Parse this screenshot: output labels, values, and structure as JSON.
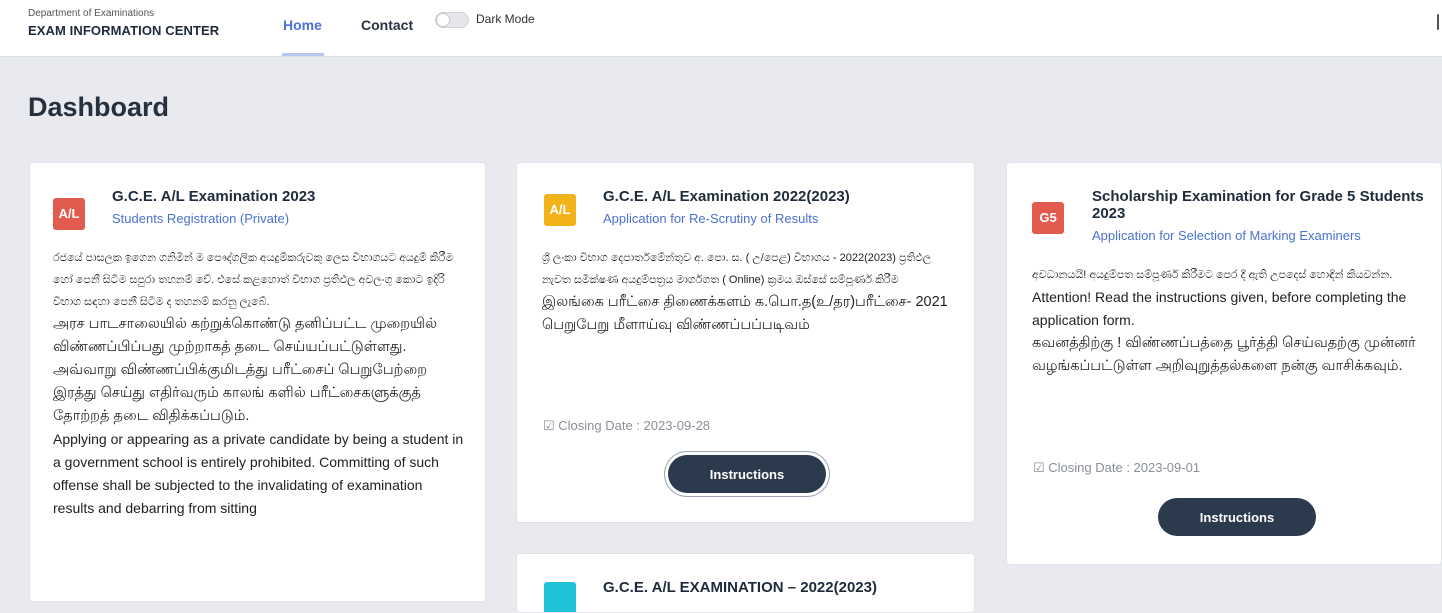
{
  "header": {
    "dept": "Department of Examinations",
    "brand": "EXAM INFORMATION CENTER",
    "nav": {
      "home": "Home",
      "contact": "Contact"
    },
    "dark_mode_label": "Dark Mode"
  },
  "page": {
    "title": "Dashboard"
  },
  "cards": [
    {
      "badge": "A/L",
      "badge_color": "#e35b4f",
      "title": "G.C.E. A/L Examination 2023",
      "subtitle": "Students Registration (Private)",
      "sinhala": "රජයේ පාසලක ඉගෙන ගනිමින් ම පෞද්ගලික අයදුම්කරුවකු ලෙස විභාගයට අයදුම් කිරීම හෝ පෙනී සිටීම සපුරා තහනම් වේ. එසේ කළහොත් විභාග ප්‍රතිඵල අවලංගු කොට ඉදිරි විභාග සඳහා පෙනී සිටීම ද තහනම් කරනු ලැබේ.",
      "tamil": "அரச பாடசாலையில் கற்றுக்கொண்டு தனிப்பட்ட முறையில் விண்ணப்பிப்பது முற்றாகத் தடை செய்யப்பட்டுள்ளது. அவ்வாறு விண்ணப்பிக்குமிடத்து பரீட்சைப் பெறுபேற்றை இரத்து செய்து எதிர்வரும் காலங் களில் பரீட்சைகளுக்குத் தோற்றத் தடை விதிக்கப்படும்.",
      "english": "Applying or appearing as a private candidate by being a student in a government school is entirely prohibited. Committing of such offense shall be subjected to the invalidating of examination results and debarring from sitting"
    },
    {
      "badge": "A/L",
      "badge_color": "#f1b21a",
      "title": "G.C.E. A/L Examination 2022(2023)",
      "subtitle": "Application for Re-Scrutiny of Results",
      "sinhala": "ශ්‍රී ලංකා විභාග දෙපාර්තමේන්තුව අ. පො. ස. ( උ/පෙළ) විභාගය - 2022(2023) ප්‍රතිඵල නැවත සමීක්ෂණ අයදුම්පත්‍රය මාර්ගගත ( Online) ක්‍රමය ඔස්සේ සම්පූර්ණ කිරීම",
      "tamil": "இலங்கை பரீட்சை திணைக்களம் க.பொ.த(உ/தர)பரீட்சை- 2021 பெறுபேறு மீளாய்வு விண்ணப்பப்படிவம்",
      "closing": "Closing Date : 2023-09-28",
      "button": "Instructions"
    },
    {
      "badge": "G5",
      "badge_color": "#e35b4f",
      "title": "Scholarship Examination for Grade 5 Students 2023",
      "subtitle": "Application for Selection of Marking Examiners",
      "sinhala": "අවධානයයි! අයදුම්පත සම්පූර්ණ කිරීමට පෙර දී ඇති උපදෙස් හොඳින් කියවන්න.",
      "english": "Attention! Read the instructions given, before completing the application form.",
      "tamil": "கவனத்திற்கு ! விண்ணப்பத்தை பூர்த்தி செய்வதற்கு முன்னர் வழங்கப்பட்டுள்ள அறிவுறுத்தல்களை நன்கு வாசிக்கவும்.",
      "closing": "Closing Date : 2023-09-01",
      "button": "Instructions"
    },
    {
      "badge_color": "#1fc1d6",
      "title": "G.C.E. A/L EXAMINATION – 2022(2023)"
    }
  ]
}
